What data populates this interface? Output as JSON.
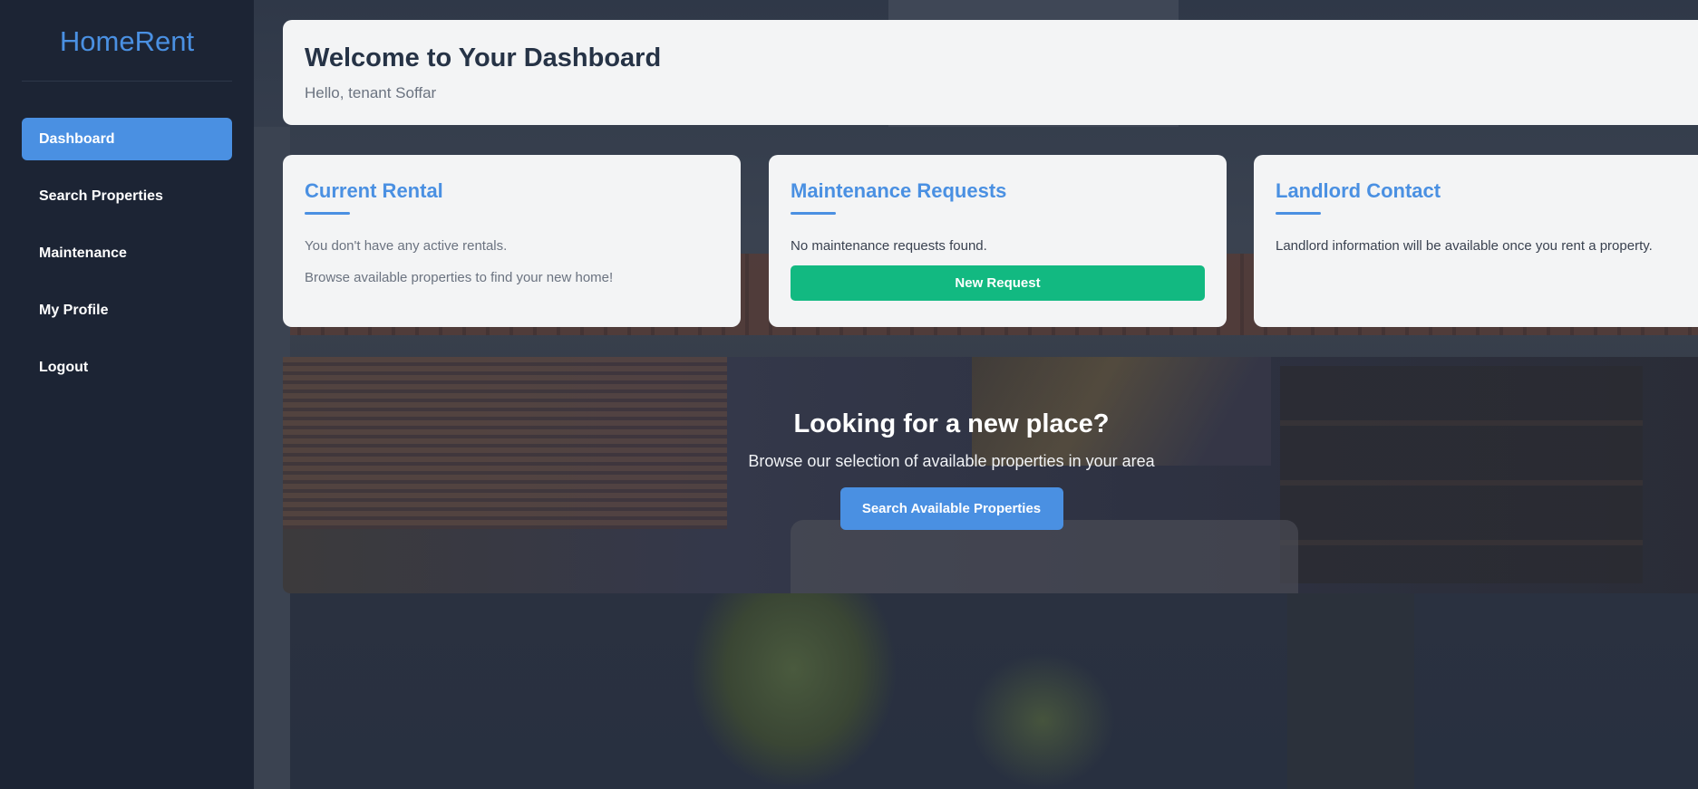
{
  "brand": {
    "name": "HomeRent"
  },
  "sidebar": {
    "items": [
      {
        "label": "Dashboard",
        "active": true
      },
      {
        "label": "Search Properties",
        "active": false
      },
      {
        "label": "Maintenance",
        "active": false
      },
      {
        "label": "My Profile",
        "active": false
      },
      {
        "label": "Logout",
        "active": false
      }
    ]
  },
  "welcome": {
    "title": "Welcome to Your Dashboard",
    "greeting": "Hello, tenant Soffar"
  },
  "cards": {
    "rental": {
      "title": "Current Rental",
      "line1": "You don't have any active rentals.",
      "line2": "Browse available properties to find your new home!"
    },
    "maintenance": {
      "title": "Maintenance Requests",
      "empty": "No maintenance requests found.",
      "button": "New Request"
    },
    "landlord": {
      "title": "Landlord Contact",
      "text": "Landlord information will be available once you rent a property."
    }
  },
  "promo": {
    "title": "Looking for a new place?",
    "subtitle": "Browse our selection of available properties in your area",
    "button": "Search Available Properties"
  },
  "colors": {
    "accent": "#4a90e2",
    "success": "#12b981",
    "sidebar_bg": "#1c2434",
    "card_bg": "#f3f4f5"
  }
}
